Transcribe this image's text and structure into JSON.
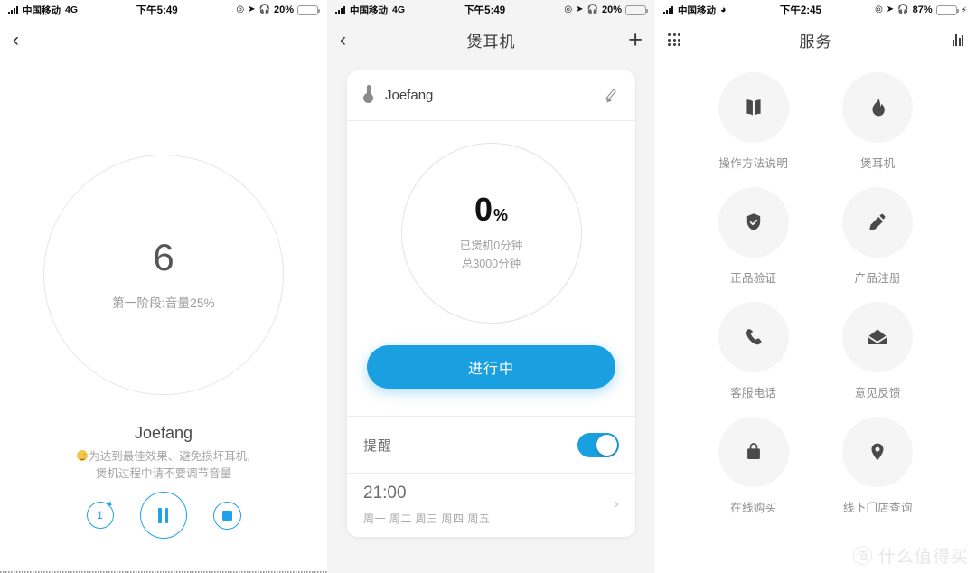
{
  "panel1": {
    "statusbar": {
      "carrier": "中国移动",
      "network": "4G",
      "time": "下午5:49",
      "battery_pct": "20%"
    },
    "nav": {
      "back_icon": "chevron-left-icon"
    },
    "ring": {
      "value": "6",
      "stage": "第一阶段:音量25%"
    },
    "device_name": "Joefang",
    "tip_line1": "为达到最佳效果、避免损坏耳机,",
    "tip_line2": "煲机过程中请不要调节音量",
    "controls": {
      "loop_label": "1",
      "loop_name": "repeat-one-button",
      "pause_name": "pause-button",
      "stop_name": "stop-button"
    }
  },
  "panel2": {
    "statusbar": {
      "carrier": "中国移动",
      "network": "4G",
      "time": "下午5:49",
      "battery_pct": "20%"
    },
    "nav": {
      "title": "煲耳机",
      "back_icon": "chevron-left-icon",
      "add_icon": "plus-icon"
    },
    "card": {
      "device_name": "Joefang",
      "edit_icon": "pencil-icon",
      "percent": "0",
      "percent_unit": "%",
      "sub_line1": "已煲机0分钟",
      "sub_line2": "总3000分钟",
      "cta_label": "进行中",
      "remind_label": "提醒",
      "remind_on": "true",
      "alarm_time": "21:00",
      "alarm_days": "周一 周二 周三 周四 周五"
    }
  },
  "panel3": {
    "statusbar": {
      "carrier": "中国移动",
      "network": "wifi",
      "time": "下午2:45",
      "battery_pct": "87%"
    },
    "nav": {
      "title": "服务",
      "grid_icon": "apps-grid-icon",
      "chart_icon": "bar-chart-icon"
    },
    "services": [
      {
        "label": "操作方法说明",
        "icon": "book-icon"
      },
      {
        "label": "煲耳机",
        "icon": "flame-icon"
      },
      {
        "label": "正品验证",
        "icon": "shield-check-icon"
      },
      {
        "label": "产品注册",
        "icon": "pencil-icon"
      },
      {
        "label": "客服电话",
        "icon": "phone-icon"
      },
      {
        "label": "意见反馈",
        "icon": "envelope-icon"
      },
      {
        "label": "在线购买",
        "icon": "shopping-bag-icon"
      },
      {
        "label": "线下门店查询",
        "icon": "map-pin-icon"
      }
    ],
    "watermark": {
      "badge": "值",
      "text": "什么值得买"
    }
  },
  "colors": {
    "accent": "#1a9fe0",
    "ring": "#e5e5e5",
    "text_muted": "#a2a2a2",
    "battery_good": "#4cd964",
    "battery_low": "#f7c548"
  }
}
